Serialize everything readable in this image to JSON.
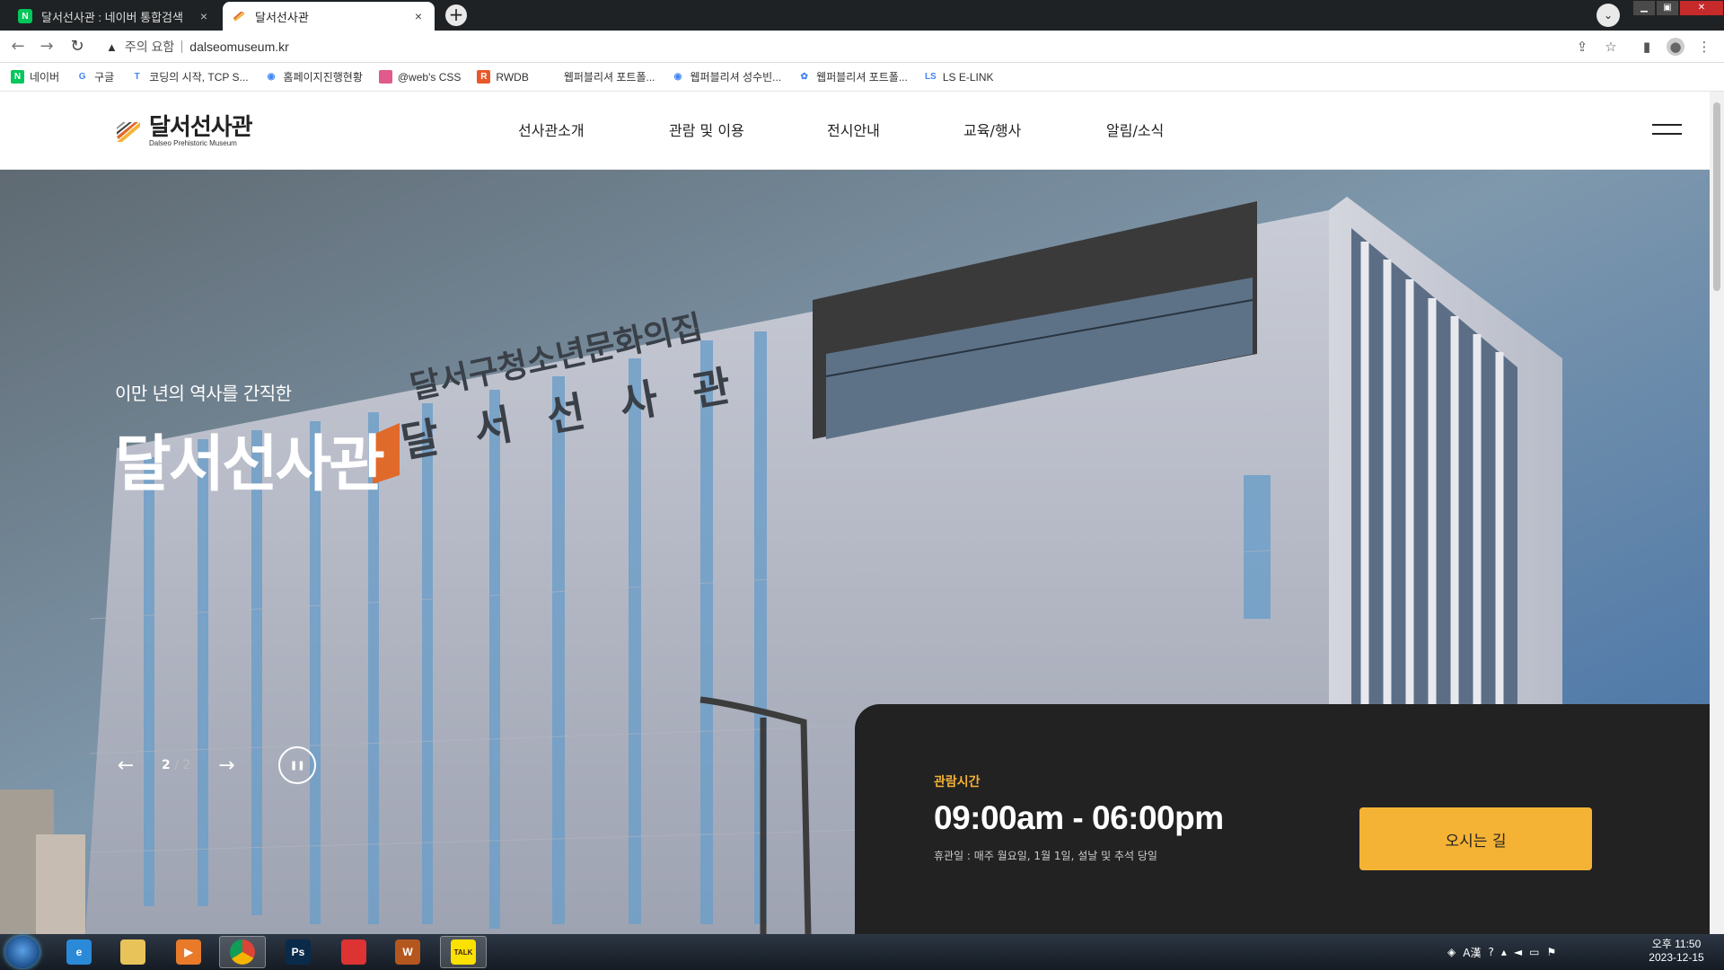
{
  "browser": {
    "tabs": [
      {
        "title": "달서선사관 : 네이버 통합검색",
        "favicon": "naver-icon",
        "active": false
      },
      {
        "title": "달서선사관",
        "favicon": "museum-icon",
        "active": true
      }
    ],
    "close_glyph": "×",
    "new_tab_glyph": "+",
    "address": {
      "security_label": "주의 요함",
      "url": "dalseomuseum.kr"
    },
    "bookmarks": [
      {
        "label": "네이버",
        "icon": "naver-icon",
        "color": "#03c75a",
        "glyph": "N"
      },
      {
        "label": "구글",
        "icon": "google-icon",
        "color": "#ffffff",
        "glyph": "G"
      },
      {
        "label": "코딩의 시작, TCP S...",
        "icon": "tcp-icon",
        "color": "#ffffff",
        "glyph": "T"
      },
      {
        "label": "홈페이지진행현황",
        "icon": "globe-icon",
        "color": "#ffffff",
        "glyph": "◉"
      },
      {
        "label": "@web's CSS",
        "icon": "css-icon",
        "color": "#e05a8c",
        "glyph": ""
      },
      {
        "label": "RWDB",
        "icon": "rwdb-icon",
        "color": "#e8582a",
        "glyph": "R"
      },
      {
        "label": "웹퍼블리셔 포트폴...",
        "icon": "blank-icon",
        "color": "#ffffff",
        "glyph": ""
      },
      {
        "label": "웹퍼블리셔 성수빈...",
        "icon": "globe-icon",
        "color": "#ffffff",
        "glyph": "◉"
      },
      {
        "label": "웹퍼블리셔 포트폴...",
        "icon": "leaf-icon",
        "color": "#ffffff",
        "glyph": "✿"
      },
      {
        "label": "LS E-LINK",
        "icon": "ls-icon",
        "color": "#ffffff",
        "glyph": "LS"
      }
    ]
  },
  "site": {
    "logo": {
      "ko": "달서선사관",
      "en": "Dalseo Prehistoric Museum"
    },
    "nav": [
      "선사관소개",
      "관람 및 이용",
      "전시안내",
      "교육/행사",
      "알림/소식"
    ],
    "hero": {
      "subtitle": "이만 년의 역사를 간직한",
      "title": "달서선사관",
      "current_slide": "2",
      "slide_sep": " / ",
      "total_slides": "2",
      "prev_glyph": "←",
      "next_glyph": "→",
      "pause_glyph": "❚❚"
    },
    "hours": {
      "label": "관람시간",
      "time": "09:00am - 06:00pm",
      "closed": "휴관일 : 매주 월요일, 1월 1일, 설날 및 추석 당일",
      "directions": "오시는 길"
    },
    "accent_color": "#f5b335"
  },
  "taskbar": {
    "apps": [
      {
        "name": "ie-icon",
        "glyph": "e",
        "color": "#2b8ad8"
      },
      {
        "name": "folder-icon",
        "glyph": "",
        "color": "#e8c35a"
      },
      {
        "name": "media-player-icon",
        "glyph": "▶",
        "color": "#e87a2a"
      },
      {
        "name": "chrome-icon",
        "glyph": "",
        "color": "#dd4b39"
      },
      {
        "name": "photoshop-icon",
        "glyph": "Ps",
        "color": "#0a2a4a"
      },
      {
        "name": "eraser-icon",
        "glyph": "",
        "color": "#d33"
      },
      {
        "name": "winamp-icon",
        "glyph": "W",
        "color": "#b4571f"
      },
      {
        "name": "kakaotalk-icon",
        "glyph": "TALK",
        "color": "#fae100"
      }
    ],
    "clock": {
      "time": "오후 11:50",
      "date": "2023-12-15"
    }
  }
}
